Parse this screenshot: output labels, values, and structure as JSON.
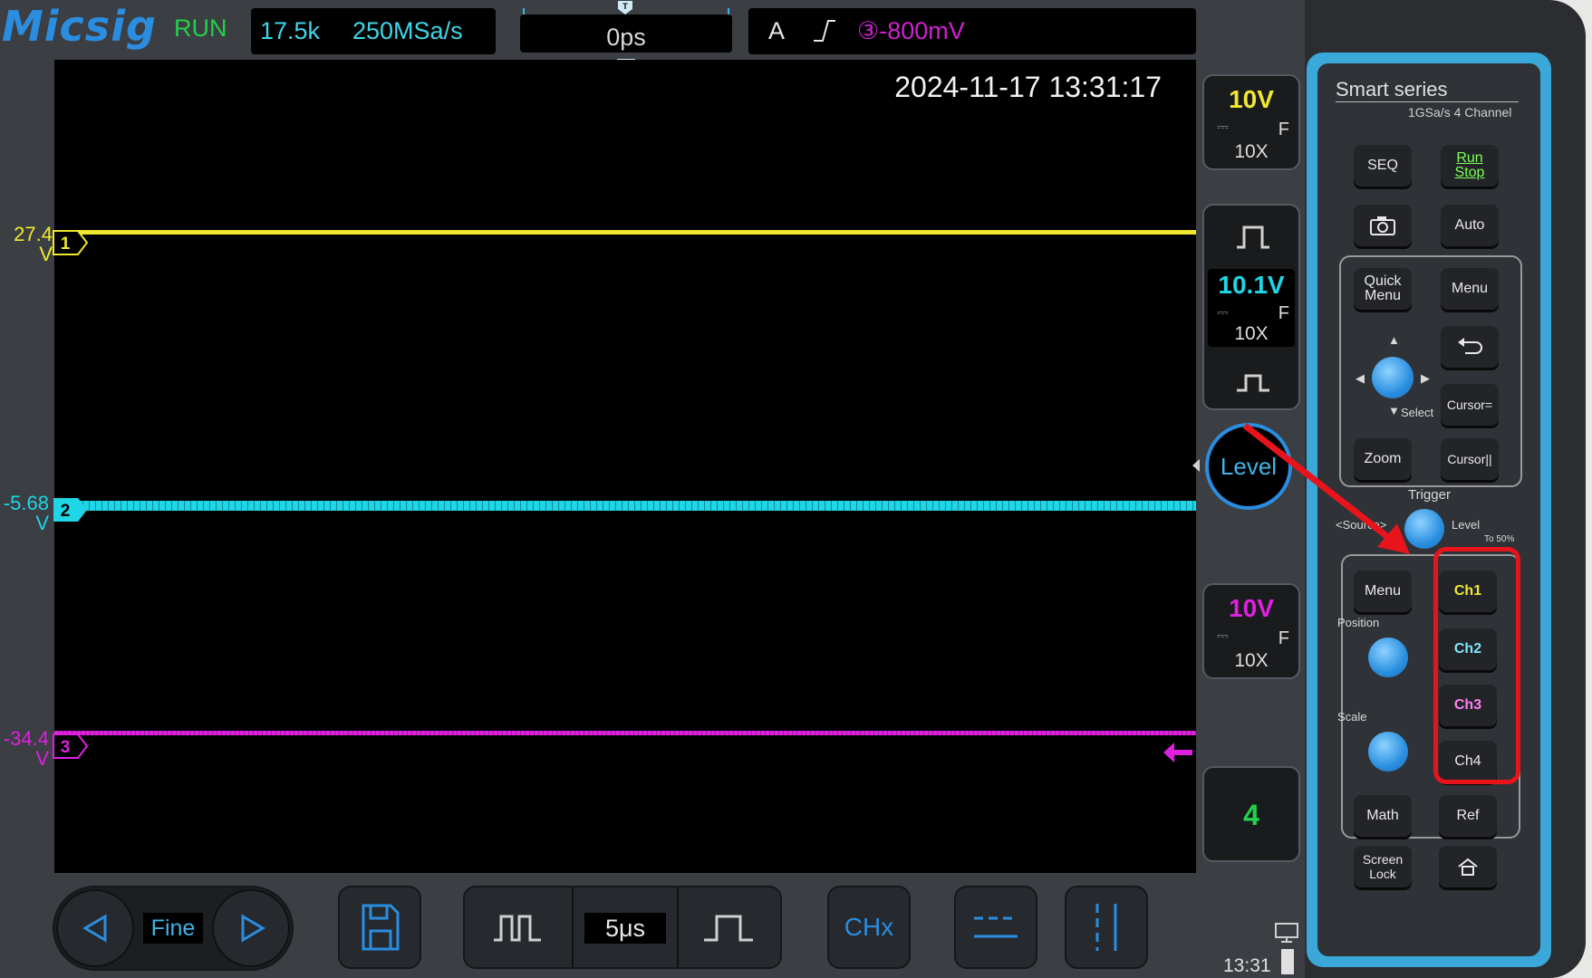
{
  "topbar": {
    "brand": "Micsig",
    "run_state": "RUN",
    "memory_depth": "17.5k",
    "sample_rate": "250MSa/s",
    "trigger_position": "0ps",
    "trigger_mode": "A",
    "trigger_source_level": "③-800mV"
  },
  "screen": {
    "timestamp": "2024-11-17 13:31:17",
    "traces": [
      {
        "channel": "1",
        "offset_value": "27.4",
        "unit": "V",
        "color": "#f0e830"
      },
      {
        "channel": "2",
        "offset_value": "-5.68",
        "unit": "V",
        "color": "#1ed6e6"
      },
      {
        "channel": "3",
        "offset_value": "-34.4",
        "unit": "V",
        "color": "#e020e0"
      }
    ]
  },
  "right_panel": {
    "ch1": {
      "scale": "10V",
      "coupling": "F",
      "probe": "10X",
      "color": "#f0e830"
    },
    "ch2": {
      "scale": "10.1V",
      "coupling": "F",
      "probe": "10X",
      "color": "#1ed6e6"
    },
    "level_label": "Level",
    "ch3": {
      "scale": "10V",
      "coupling": "F",
      "probe": "10X",
      "color": "#e020e0"
    },
    "ch4_label": "4"
  },
  "bottombar": {
    "fine_label": "Fine",
    "timebase": "5μs",
    "chx_label": "CHx",
    "clock": "13:31"
  },
  "device": {
    "series": "Smart series",
    "spec": "1GSa/s 4 Channel",
    "keys": {
      "seq": "SEQ",
      "run_stop_1": "Run",
      "run_stop_2": "Stop",
      "auto": "Auto",
      "quick_menu_1": "Quick",
      "quick_menu_2": "Menu",
      "menu": "Menu",
      "cursor_eq": "Cursor=",
      "zoom": "Zoom",
      "cursor_ll": "Cursor||",
      "menu2": "Menu",
      "ch1": "Ch1",
      "ch2": "Ch2",
      "ch3": "Ch3",
      "ch4": "Ch4",
      "math": "Math",
      "ref": "Ref",
      "screen_lock_1": "Screen",
      "screen_lock_2": "Lock"
    },
    "labels": {
      "select": "Select",
      "trigger": "Trigger",
      "source": "<Source>",
      "level": "Level",
      "to50": "To 50%",
      "position": "Position",
      "scale": "Scale"
    },
    "highlight_color": "#e8141c"
  }
}
